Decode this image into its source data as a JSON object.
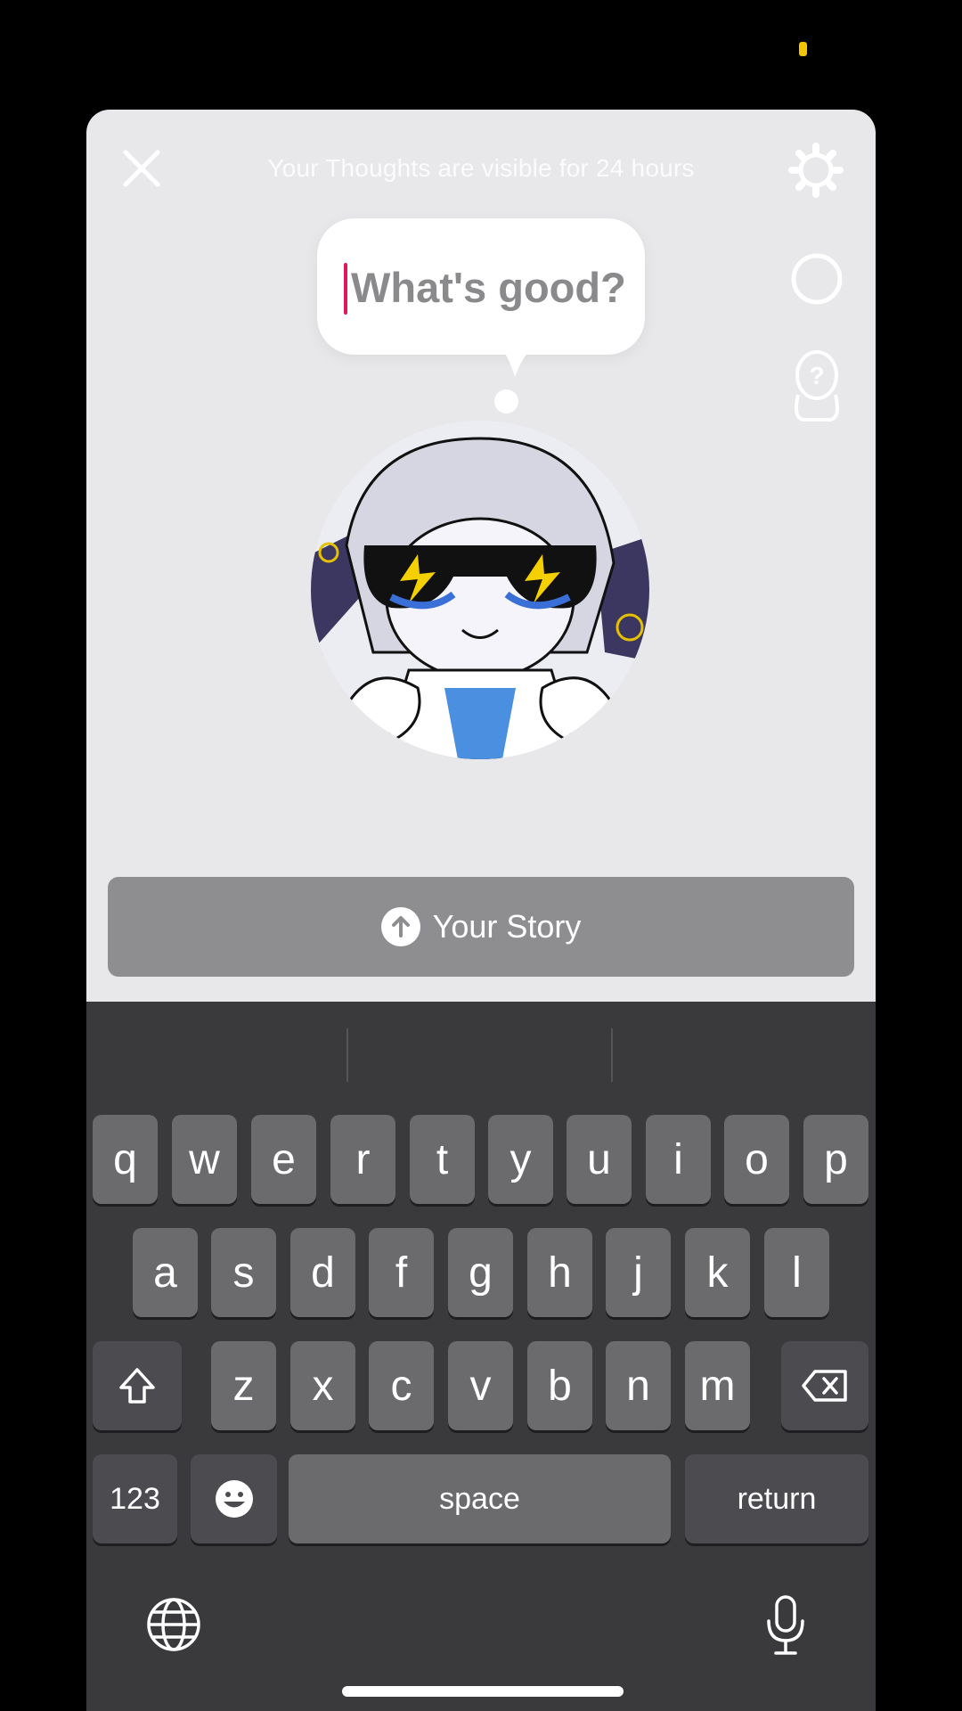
{
  "status": {
    "indicator_color": "#f5c400"
  },
  "header": {
    "caption": "Your Thoughts are visible for 24 hours",
    "close_icon": "close-icon",
    "settings_icon": "gear-icon"
  },
  "side_tools": [
    "ring-icon",
    "help-bitmoji-icon"
  ],
  "thought": {
    "placeholder": "What's good?",
    "value": ""
  },
  "story_button": {
    "label": "Your Story",
    "icon": "arrow-up-icon"
  },
  "keyboard": {
    "row1": [
      "q",
      "w",
      "e",
      "r",
      "t",
      "y",
      "u",
      "i",
      "o",
      "p"
    ],
    "row2": [
      "a",
      "s",
      "d",
      "f",
      "g",
      "h",
      "j",
      "k",
      "l"
    ],
    "row3": [
      "z",
      "x",
      "c",
      "v",
      "b",
      "n",
      "m"
    ],
    "numbers_label": "123",
    "space_label": "space",
    "return_label": "return",
    "shift_icon": "shift-icon",
    "delete_icon": "backspace-icon",
    "emoji_icon": "emoji-icon",
    "globe_icon": "globe-icon",
    "mic_icon": "microphone-icon"
  },
  "colors": {
    "accent_caret": "#e0185e",
    "sheet_bg": "#e8e8ea"
  }
}
